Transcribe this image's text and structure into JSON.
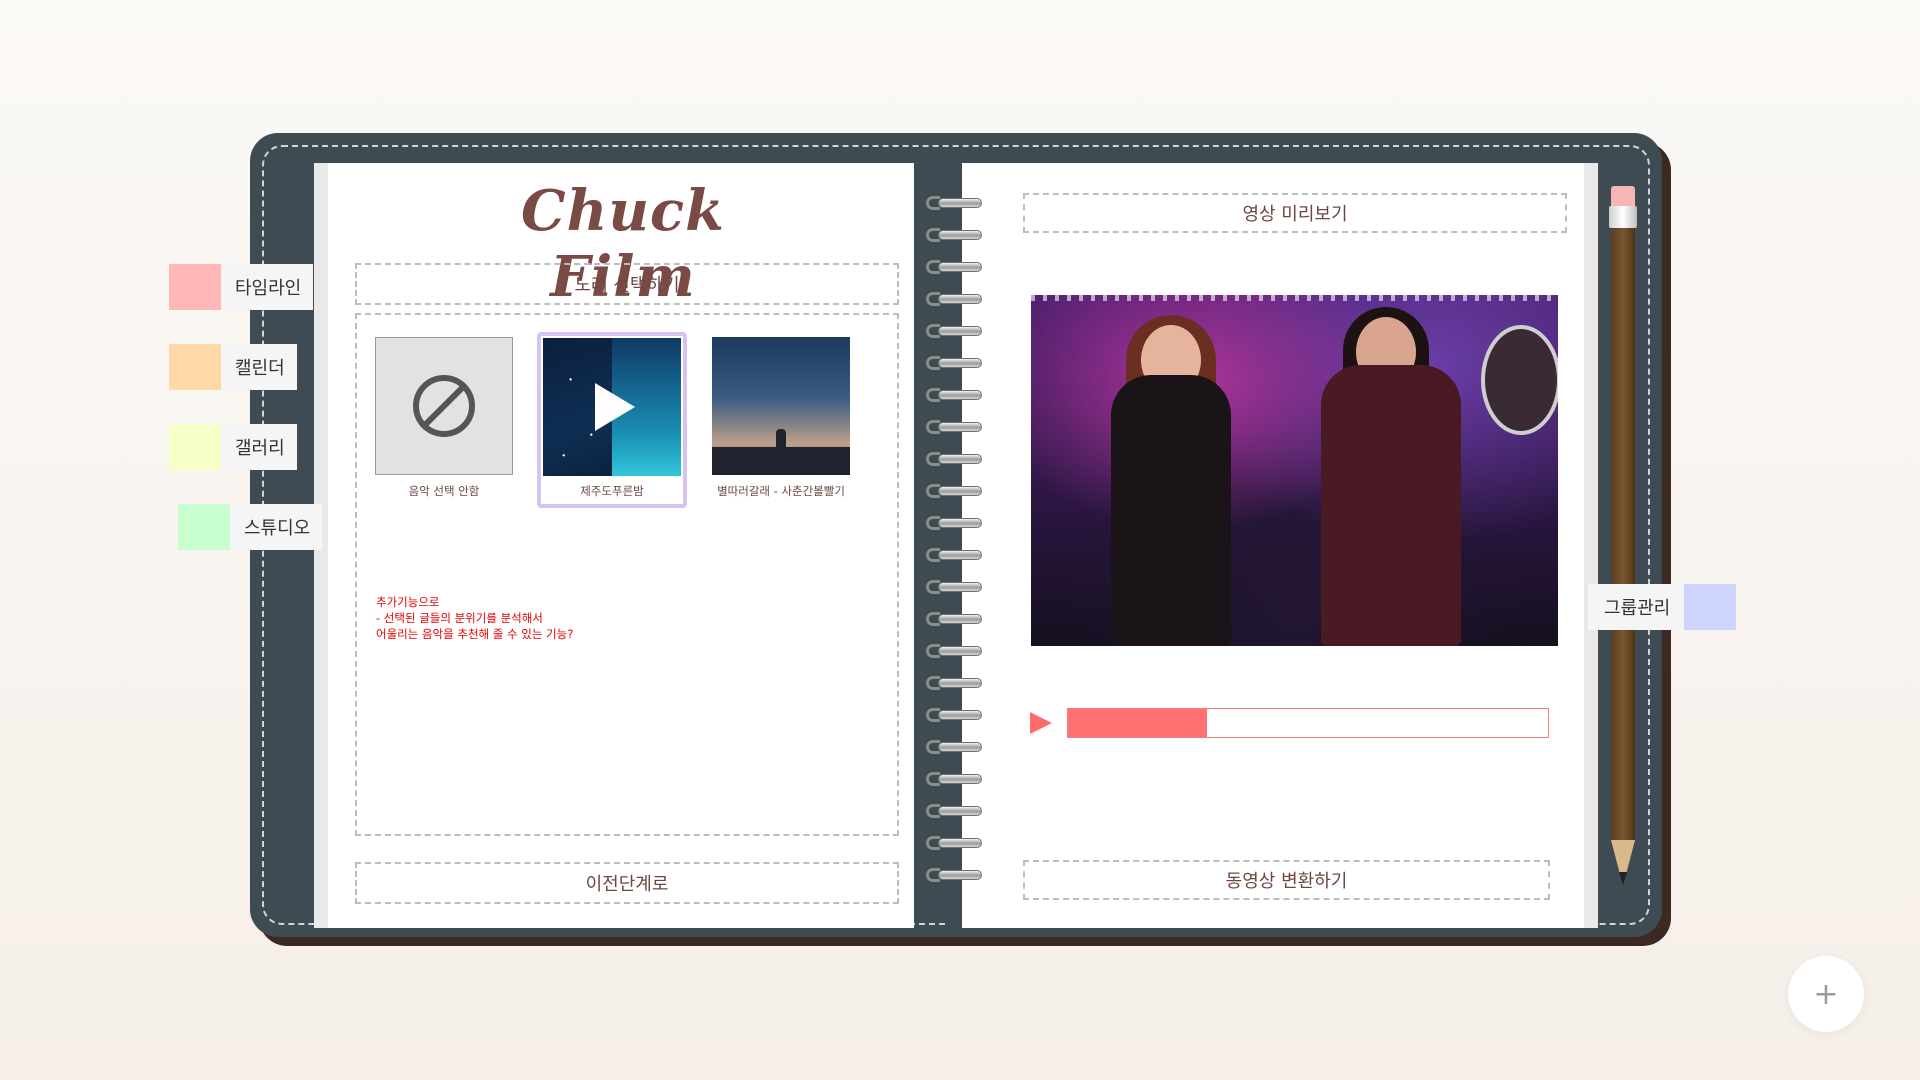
{
  "app": {
    "brand_title": "Chuck Film"
  },
  "side_tabs": [
    {
      "label": "타임라인",
      "color": "#ffb7b7"
    },
    {
      "label": "캘린더",
      "color": "#ffd8a8"
    },
    {
      "label": "갤러리",
      "color": "#f7ffc9"
    },
    {
      "label": "스튜디오",
      "color": "#c9ffcf"
    }
  ],
  "group_tab": {
    "label": "그룹관리",
    "color": "#cfd4ff"
  },
  "left_page": {
    "section_header": "노래 선택하기",
    "music_items": [
      {
        "caption": "음악 선택 안함",
        "icon": "no-music-icon",
        "selected": false
      },
      {
        "caption": "제주도푸른밤",
        "icon": "play-icon",
        "selected": true
      },
      {
        "caption": "별따러갈래 - 사춘간볼빨기",
        "icon": "album-art",
        "selected": false
      }
    ],
    "note_lines": [
      "추가기능으로",
      "- 선택된 글들의 분위기를 분석해서",
      "어울리는 음악을 추천해 줄 수 있는 기능?"
    ],
    "prev_button": "이전단계로"
  },
  "right_page": {
    "preview_header": "영상 미리보기",
    "progress": 0.29,
    "convert_button": "동영상 변환하기"
  },
  "fab": {
    "label": "+"
  },
  "colors": {
    "cover": "#3f4b52",
    "title": "#7a4a44",
    "progress_fill": "#ff7070",
    "selected_border": "#d5c4f2",
    "note": "#e60000"
  }
}
